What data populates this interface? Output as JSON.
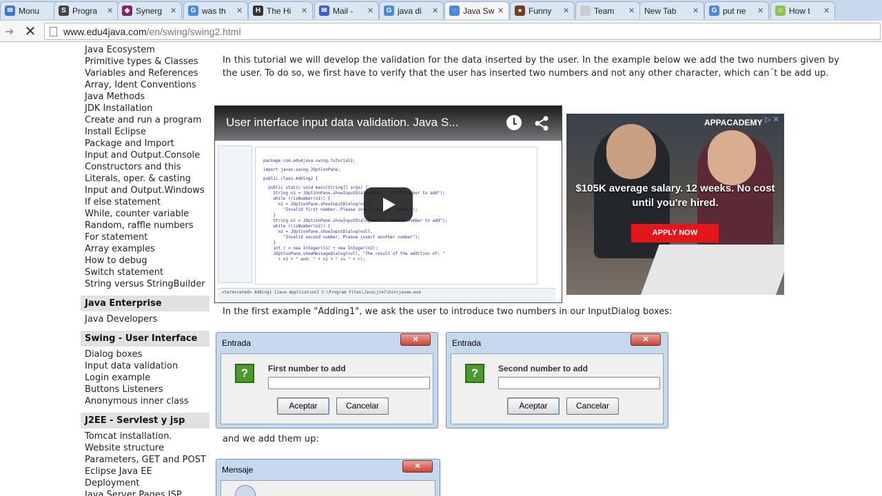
{
  "browser": {
    "tabs": [
      {
        "title": "Monu",
        "favicon_color": "#3b74d6",
        "favicon_glyph": "✉",
        "active": false
      },
      {
        "title": "Progra",
        "favicon_color": "#444444",
        "favicon_glyph": "S",
        "active": false
      },
      {
        "title": "Synerg",
        "favicon_color": "#8a1f6c",
        "favicon_glyph": "◆",
        "active": false
      },
      {
        "title": "was th",
        "favicon_color": "#4a89dc",
        "favicon_glyph": "G",
        "active": false
      },
      {
        "title": "The Hi",
        "favicon_color": "#333333",
        "favicon_glyph": "H",
        "active": false
      },
      {
        "title": "Mail -",
        "favicon_color": "#3b5fc7",
        "favicon_glyph": "✉",
        "active": false
      },
      {
        "title": "java di",
        "favicon_color": "#4a89dc",
        "favicon_glyph": "G",
        "active": false
      },
      {
        "title": "Java Sw",
        "favicon_color": "#4a89dc",
        "favicon_glyph": "◌",
        "active": true
      },
      {
        "title": "Funny",
        "favicon_color": "#7a3a1f",
        "favicon_glyph": "●",
        "active": false
      },
      {
        "title": "Team",
        "favicon_color": "#cccccc",
        "favicon_glyph": "",
        "active": false
      },
      {
        "title": "New Tab",
        "favicon_color": "",
        "favicon_glyph": "",
        "active": false
      },
      {
        "title": "put ne",
        "favicon_color": "#4a89dc",
        "favicon_glyph": "G",
        "active": false
      },
      {
        "title": "How t",
        "favicon_color": "#8bc34a",
        "favicon_glyph": "☺",
        "active": false
      }
    ],
    "close_glyph": "✕",
    "url_host": "www.edu4java.com",
    "url_path": "/en/swing/swing2.html",
    "forward_glyph": "➜",
    "stop_glyph": "✕"
  },
  "sidebar": {
    "links_top": [
      "Java Ecosystem",
      "Primitive types & Classes",
      "Variables and References",
      "Array, Ident Conventions",
      "Java Methods",
      "JDK Installation",
      "Create and run a program",
      "Install Eclipse",
      "Package and Import",
      "Input and Output.Console",
      "Constructors and this",
      "Literals, oper. & casting",
      "Input and Output.Windows",
      "If else statement",
      "While, counter variable",
      "Random, raffle numbers",
      "For statement",
      "Array examples",
      "How to debug",
      "Switch statement",
      "String versus StringBuilder"
    ],
    "sections": [
      {
        "heading": "Java Enterprise",
        "links": [
          "Java Developers"
        ]
      },
      {
        "heading": "Swing - User Interface",
        "links": [
          "Dialog boxes",
          "Input data validation",
          "Login example",
          "Buttons Listeners",
          "Anonymous inner class"
        ]
      },
      {
        "heading": "J2EE - Servlest y jsp",
        "links": [
          "Tomcat installation.",
          "Website structure",
          "Parameters, GET and POST",
          "Eclipse Java EE",
          "Deployment",
          "Java Server Pages JSP"
        ]
      }
    ]
  },
  "content": {
    "intro": "In this tutorial we will develop the validation for the data inserted by the user. In the example below we add the two numbers given by the user. To do so, we first have to verify that the user has inserted two numbers and not any other character, which can´t be add up.",
    "first_example": "In the first example \"Adding1\", we ask the user to introduce two numbers in our InputDialog boxes:",
    "add_up": "and we add them up:"
  },
  "video": {
    "title": "User interface input data validation. Java S...",
    "code_lines": [
      "package com.edu4java.swing.tutorial2;",
      "import javax.swing.JOptionPane;",
      "public class Adding2 {",
      "  public static void main(String[] args) {",
      "    String n1 = JOptionPane.showInputDialog(null, \"First number to add\");",
      "    while (!isNumber(n1)) {",
      "      n1 = JOptionPane.showInputDialog(null,",
      "        \"Invalid first number. Please insert another number\");",
      "    }",
      "    String n2 = JOptionPane.showInputDialog(null, \"Second number to add\");",
      "    while (!isNumber(n2)) {",
      "      n2 = JOptionPane.showInputDialog(null,",
      "        \"Invalid second number. Please insert another number\");",
      "    }",
      "    int r = new Integer(n1) + new Integer(n2);",
      "    JOptionPane.showMessageDialog(null, \"The result of the addition of: \"",
      "      + n1 + \" and: \" + n2 + \" is \" + r);"
    ],
    "editor_tabs": [
      "Adding1.java",
      "Adding2.java"
    ],
    "console_line": "<terminated> Adding1 [Java Application] C:\\Program Files\\Java\\jre7\\bin\\javaw.exe"
  },
  "ad": {
    "brand": "APPACADEMY",
    "adchoices": "▷ ✕",
    "headline": "$105K average salary. 12 weeks. No cost until you're hired.",
    "cta": "APPLY NOW"
  },
  "dialogs": [
    {
      "title": "Entrada",
      "label": "First number to add",
      "ok": "Aceptar",
      "cancel": "Cancelar"
    },
    {
      "title": "Entrada",
      "label": "Second number to add",
      "ok": "Aceptar",
      "cancel": "Cancelar"
    }
  ],
  "message_dialog": {
    "title": "Mensaje"
  },
  "icons": {
    "question": "?",
    "dialog_close": "✕"
  }
}
